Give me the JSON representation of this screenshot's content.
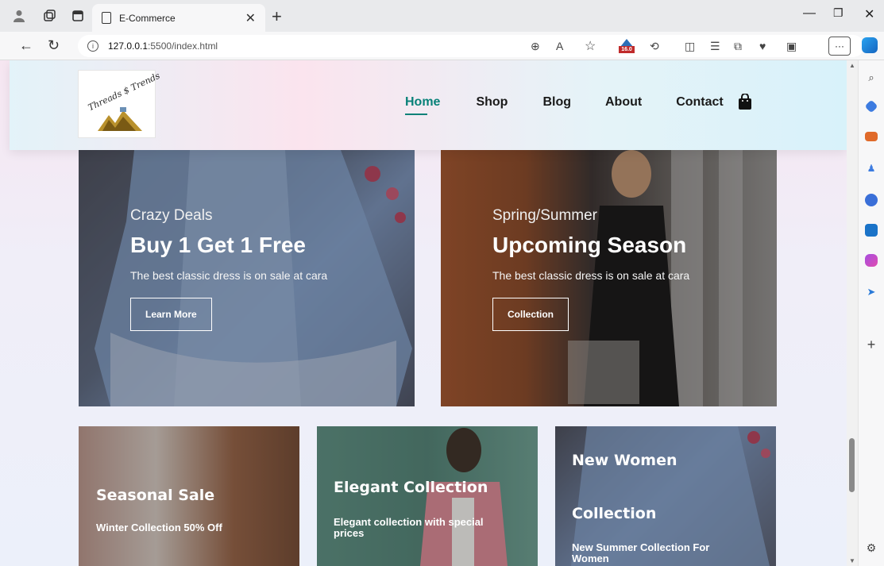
{
  "browser": {
    "tab_title": "E-Commerce",
    "url_host": "127.0.0.1",
    "url_rest": ":5500/index.html",
    "badge_number": "16.0"
  },
  "site": {
    "logo_text": "Threads $ Trends",
    "nav": {
      "home": "Home",
      "shop": "Shop",
      "blog": "Blog",
      "about": "About",
      "contact": "Contact"
    },
    "accent_color": "#088178"
  },
  "banners": {
    "left": {
      "small": "Crazy Deals",
      "big": "Buy 1 Get 1 Free",
      "desc": "The best classic dress is on sale at cara",
      "button": "Learn More"
    },
    "right": {
      "small": "Spring/Summer",
      "big": "Upcoming Season",
      "desc": "The best classic dress is on sale at cara",
      "button": "Collection"
    }
  },
  "small_banners": [
    {
      "title": "Seasonal Sale",
      "sub": "Winter Collection 50% Off"
    },
    {
      "title": "Elegant Collection",
      "sub": "Elegant collection with special prices"
    },
    {
      "title": "New Women Collection",
      "title_line1": "New Women",
      "title_line2": "Collection",
      "sub": "New Summer Collection For Women"
    }
  ],
  "icons": [
    "profile-icon",
    "tab-actions-icon",
    "workspaces-icon",
    "close-icon",
    "add-tab-icon",
    "back-icon",
    "refresh-icon",
    "info-icon",
    "zoom-icon",
    "read-aloud-icon",
    "favorite-icon",
    "extensions-icon",
    "split-screen-icon",
    "favorites-list-icon",
    "collections-icon",
    "performance-icon",
    "screenshot-icon",
    "more-icon",
    "copilot-icon",
    "bag-icon",
    "search-icon",
    "settings-icon"
  ]
}
